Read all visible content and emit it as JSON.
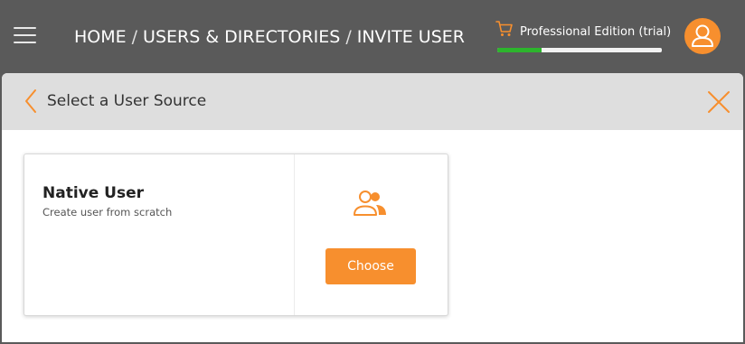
{
  "header": {
    "breadcrumb": [
      "HOME",
      "USERS & DIRECTORIES",
      "INVITE USER"
    ],
    "separator": "/",
    "edition_label": "Professional Edition (trial)",
    "trial_progress_fraction": 0.27
  },
  "panel": {
    "title": "Select a User Source"
  },
  "source_card": {
    "title": "Native User",
    "subtitle": "Create user from scratch",
    "button_label": "Choose"
  },
  "icons": {
    "menu": "hamburger-menu-icon",
    "cart": "shopping-cart-icon",
    "avatar": "user-avatar-icon",
    "back": "chevron-left-icon",
    "close": "close-icon",
    "users": "users-icon"
  },
  "colors": {
    "topbar": "#5a5a5a",
    "accent": "#f78f2e",
    "progress": "#2db52d",
    "panel_header": "#dedede"
  }
}
